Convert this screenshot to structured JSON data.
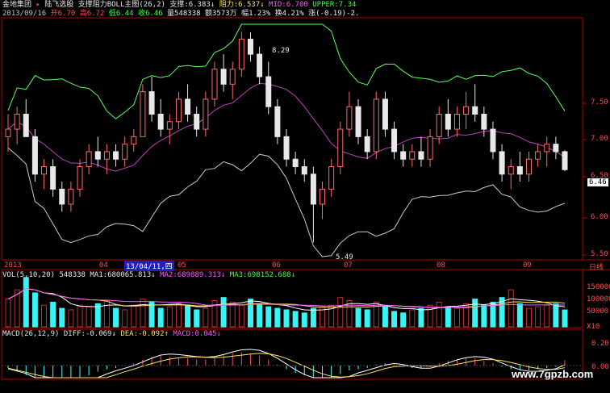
{
  "header": {
    "line1": {
      "stock": "金地集团",
      "arrow": "▸",
      "tab": "陆飞选股",
      "main_label": "支撑阻力BOLL主图(26,2)",
      "support": "支撑:6.383↓",
      "resistance": "阻力:6.537↓",
      "mid": "MID:6.700",
      "upper": "UPPER:7.34"
    },
    "line2": {
      "date": "2013/09/16",
      "open": "开6.70",
      "high": "高6.72",
      "low": "低6.44",
      "close": "收6.46",
      "volume": "量548338",
      "amount": "额3573万",
      "change": "幅1.23%",
      "turnover": "换4.21%",
      "diff": "涨(-0.19)-2."
    }
  },
  "price_axis": {
    "ticks": [
      "7.50",
      "7.00",
      "6.50",
      "6.00",
      "5.50"
    ],
    "current": "6.46"
  },
  "annotations": {
    "high_label": "8.29",
    "low_label": "5.49"
  },
  "xaxis": {
    "labels": [
      "2013",
      "04",
      "05",
      "06",
      "07",
      "08",
      "09"
    ],
    "cursor_date": "13/04/11,四",
    "period": "日线"
  },
  "vol_panel": {
    "title": "VOL(5,10,20)",
    "value": "548338",
    "ma1": "MA1:680065.813↓",
    "ma2": "MA2:689889.313↓",
    "ma3": "MA3:698152.688↓",
    "ticks": [
      "150000",
      "100000",
      "50000"
    ],
    "unit": "X10"
  },
  "macd_panel": {
    "title": "MACD(26,12,9)",
    "diff": "DIFF:-0.069↓",
    "dea": "DEA:-0.092↑",
    "macd": "MACD:0.045↓",
    "ticks": [
      "0.20",
      "0.00"
    ]
  },
  "watermark": "www.7gpzb.com",
  "colors": {
    "up": "#ff6a6a",
    "down": "#e8e8e8",
    "up_vol": "#c03030",
    "down_vol": "#38f4f4",
    "boll_upper": "#5aff5a",
    "boll_mid": "#c040c0",
    "boll_lower": "#cccccc",
    "axis": "#b00000",
    "bg": "#000000"
  },
  "chart_data": [
    {
      "type": "candlestick",
      "title": "支撑阻力BOLL主图(26,2)",
      "y_range": [
        5.3,
        8.4
      ],
      "x_labels": [
        "2013",
        "04",
        "05",
        "06",
        "07",
        "08",
        "09"
      ],
      "ohlc_approx": [
        [
          6.9,
          7.2,
          6.7,
          7.0
        ],
        [
          7.0,
          7.3,
          6.8,
          7.2
        ],
        [
          7.2,
          7.4,
          6.9,
          6.9
        ],
        [
          6.9,
          7.0,
          6.3,
          6.4
        ],
        [
          6.4,
          6.6,
          6.2,
          6.5
        ],
        [
          6.5,
          6.6,
          6.1,
          6.2
        ],
        [
          6.2,
          6.3,
          5.9,
          6.0
        ],
        [
          6.0,
          6.3,
          5.9,
          6.2
        ],
        [
          6.2,
          6.6,
          6.1,
          6.5
        ],
        [
          6.5,
          6.8,
          6.4,
          6.7
        ],
        [
          6.7,
          6.9,
          6.5,
          6.6
        ],
        [
          6.6,
          6.8,
          6.4,
          6.7
        ],
        [
          6.7,
          6.8,
          6.5,
          6.6
        ],
        [
          6.6,
          6.9,
          6.5,
          6.8
        ],
        [
          6.8,
          7.0,
          6.7,
          6.9
        ],
        [
          6.9,
          7.6,
          6.9,
          7.5
        ],
        [
          7.5,
          7.7,
          7.1,
          7.2
        ],
        [
          7.2,
          7.4,
          6.9,
          7.0
        ],
        [
          7.0,
          7.2,
          6.8,
          7.1
        ],
        [
          7.1,
          7.5,
          7.0,
          7.4
        ],
        [
          7.4,
          7.6,
          7.1,
          7.2
        ],
        [
          7.2,
          7.3,
          6.9,
          7.0
        ],
        [
          7.0,
          7.5,
          6.9,
          7.4
        ],
        [
          7.4,
          7.9,
          7.3,
          7.8
        ],
        [
          7.8,
          8.0,
          7.5,
          7.6
        ],
        [
          7.6,
          7.9,
          7.4,
          7.8
        ],
        [
          7.8,
          8.3,
          7.7,
          8.2
        ],
        [
          8.2,
          8.29,
          7.9,
          8.0
        ],
        [
          8.0,
          8.1,
          7.6,
          7.7
        ],
        [
          7.7,
          7.9,
          7.2,
          7.3
        ],
        [
          7.3,
          7.4,
          6.8,
          6.9
        ],
        [
          6.9,
          7.0,
          6.5,
          6.6
        ],
        [
          6.6,
          6.7,
          6.4,
          6.5
        ],
        [
          6.5,
          6.6,
          6.3,
          6.4
        ],
        [
          6.4,
          6.5,
          5.49,
          6.0
        ],
        [
          6.0,
          6.3,
          5.8,
          6.2
        ],
        [
          6.2,
          6.6,
          6.1,
          6.5
        ],
        [
          6.5,
          7.1,
          6.4,
          7.0
        ],
        [
          7.0,
          7.5,
          6.9,
          7.3
        ],
        [
          7.3,
          7.4,
          6.8,
          6.9
        ],
        [
          6.9,
          7.0,
          6.6,
          6.7
        ],
        [
          6.7,
          7.5,
          6.6,
          7.4
        ],
        [
          7.4,
          7.5,
          6.9,
          7.0
        ],
        [
          7.0,
          7.1,
          6.6,
          6.7
        ],
        [
          6.7,
          6.8,
          6.5,
          6.6
        ],
        [
          6.6,
          6.8,
          6.5,
          6.7
        ],
        [
          6.7,
          6.9,
          6.5,
          6.6
        ],
        [
          6.6,
          7.0,
          6.5,
          6.9
        ],
        [
          6.9,
          7.3,
          6.8,
          7.2
        ],
        [
          7.2,
          7.4,
          6.9,
          7.0
        ],
        [
          7.0,
          7.3,
          6.9,
          7.2
        ],
        [
          7.2,
          7.5,
          7.0,
          7.3
        ],
        [
          7.3,
          7.6,
          7.1,
          7.2
        ],
        [
          7.2,
          7.3,
          6.9,
          7.0
        ],
        [
          7.0,
          7.1,
          6.6,
          6.7
        ],
        [
          6.7,
          6.8,
          6.3,
          6.4
        ],
        [
          6.4,
          6.6,
          6.2,
          6.5
        ],
        [
          6.5,
          6.7,
          6.3,
          6.4
        ],
        [
          6.4,
          6.7,
          6.3,
          6.6
        ],
        [
          6.6,
          6.8,
          6.5,
          6.7
        ],
        [
          6.7,
          6.9,
          6.5,
          6.8
        ],
        [
          6.8,
          6.9,
          6.6,
          6.7
        ],
        [
          6.7,
          6.72,
          6.44,
          6.46
        ]
      ]
    },
    {
      "type": "bar",
      "title": "VOL(5,10,20)",
      "y_range": [
        0,
        170000
      ],
      "values": [
        90000,
        120000,
        160000,
        110000,
        70000,
        80000,
        60000,
        55000,
        70000,
        65000,
        75000,
        85000,
        60000,
        55000,
        70000,
        90000,
        80000,
        60000,
        65000,
        75000,
        70000,
        55000,
        60000,
        85000,
        95000,
        80000,
        70000,
        90000,
        75000,
        65000,
        60000,
        55000,
        50000,
        45000,
        60000,
        65000,
        70000,
        95000,
        85000,
        60000,
        55000,
        80000,
        65000,
        50000,
        45000,
        55000,
        60000,
        70000,
        80000,
        65000,
        60000,
        75000,
        90000,
        70000,
        80000,
        95000,
        120000,
        75000,
        60000,
        65000,
        70000,
        75000,
        54834
      ]
    },
    {
      "type": "bar",
      "title": "MACD(26,12,9)",
      "y_range": [
        -0.2,
        0.25
      ],
      "values": [
        -0.02,
        -0.05,
        -0.08,
        -0.12,
        -0.14,
        -0.15,
        -0.15,
        -0.13,
        -0.1,
        -0.08,
        -0.05,
        -0.03,
        -0.02,
        0.0,
        0.02,
        0.05,
        0.07,
        0.08,
        0.07,
        0.06,
        0.06,
        0.05,
        0.05,
        0.07,
        0.09,
        0.1,
        0.11,
        0.1,
        0.08,
        0.05,
        0.01,
        -0.03,
        -0.06,
        -0.08,
        -0.1,
        -0.11,
        -0.1,
        -0.07,
        -0.04,
        -0.03,
        -0.02,
        0.01,
        0.02,
        0.01,
        -0.01,
        -0.02,
        -0.02,
        -0.01,
        0.02,
        0.04,
        0.05,
        0.06,
        0.06,
        0.04,
        0.02,
        -0.01,
        -0.03,
        -0.04,
        -0.04,
        -0.03,
        -0.02,
        -0.01,
        0.045
      ]
    }
  ]
}
